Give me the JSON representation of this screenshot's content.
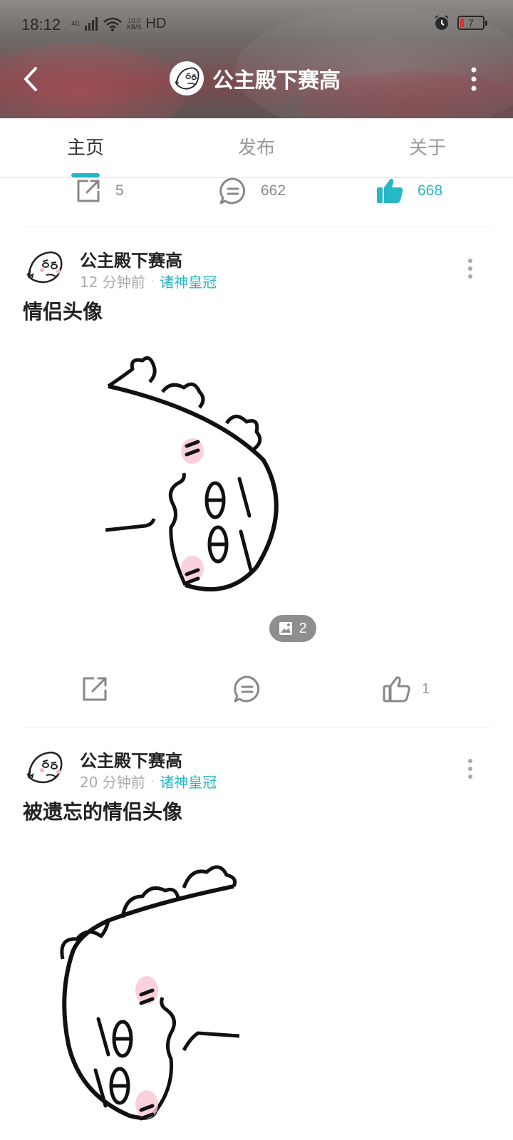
{
  "status_bar": {
    "time": "18:12",
    "network_type": "4G",
    "speed_value": "10.0",
    "speed_unit": "KB/S",
    "hd_label": "HD",
    "battery_level": "7"
  },
  "header": {
    "channel_name": "公主殿下赛高"
  },
  "tabs": [
    {
      "label": "主页",
      "active": true
    },
    {
      "label": "发布",
      "active": false
    },
    {
      "label": "关于",
      "active": false
    }
  ],
  "stats": {
    "shares": "5",
    "comments": "662",
    "likes": "668"
  },
  "posts": [
    {
      "author": "公主殿下赛高",
      "time": "12 分钟前",
      "channel": "诸神皇冠",
      "title": "情侣头像",
      "image_count": "2",
      "like_count": "1"
    },
    {
      "author": "公主殿下赛高",
      "time": "20 分钟前",
      "channel": "诸神皇冠",
      "title": "被遗忘的情侣头像"
    }
  ],
  "colors": {
    "accent": "#26b8c6",
    "text_primary": "#222222",
    "text_secondary": "#999999"
  }
}
